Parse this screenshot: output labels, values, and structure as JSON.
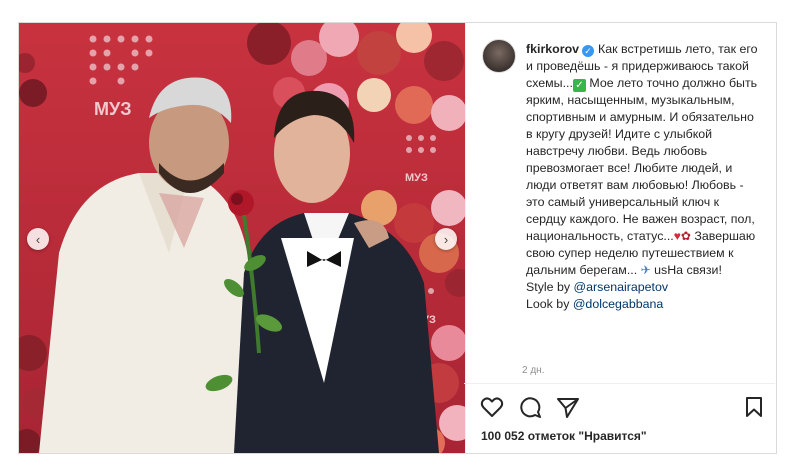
{
  "post": {
    "username": "fkirkorov",
    "caption_lines": [
      "Как встретишь лето, так",
      "его и проведёшь - я придерживаюсь",
      "такой схемы...",
      "Мое лето точно",
      "должно быть ярким, насыщенным,",
      "музыкальным, спортивным и",
      "амурным. И обязательно в кругу",
      "друзей! Идите с улыбкой навстречу",
      "любви. Ведь любовь превозмогает",
      "все! Любите людей, и люди ответят",
      "вам любовью! Любовь - это самый",
      "универсальный ключ к сердцу",
      "каждого. Не важен возраст, пол,",
      "национальность, статус...",
      "Завершаю свою супер неделю",
      "путешествием к дальним берегам...",
      "usНа связи!"
    ],
    "style_prefix": "Style by ",
    "style_mention": "@arsenairapetov",
    "look_prefix": "Look by ",
    "look_mention": "@dolcegabbana",
    "date": "2 дн.",
    "likes": "100 052 отметок \"Нравится\""
  },
  "photo": {
    "backdrop_logo": "МУЗ",
    "backdrop_logo2": "МУЗ",
    "backdrop_logo3": "МУЗ"
  },
  "icons": {
    "like": "heart-outline-icon",
    "comment": "comment-icon",
    "share": "paper-plane-icon",
    "save": "bookmark-icon",
    "prev": "chevron-left-icon",
    "next": "chevron-right-icon",
    "verified": "verified-badge-icon"
  },
  "colors": {
    "backdrop": "#c8323f",
    "verified": "#3897f0",
    "mention": "#00376b",
    "muted": "#8e8e8e"
  }
}
